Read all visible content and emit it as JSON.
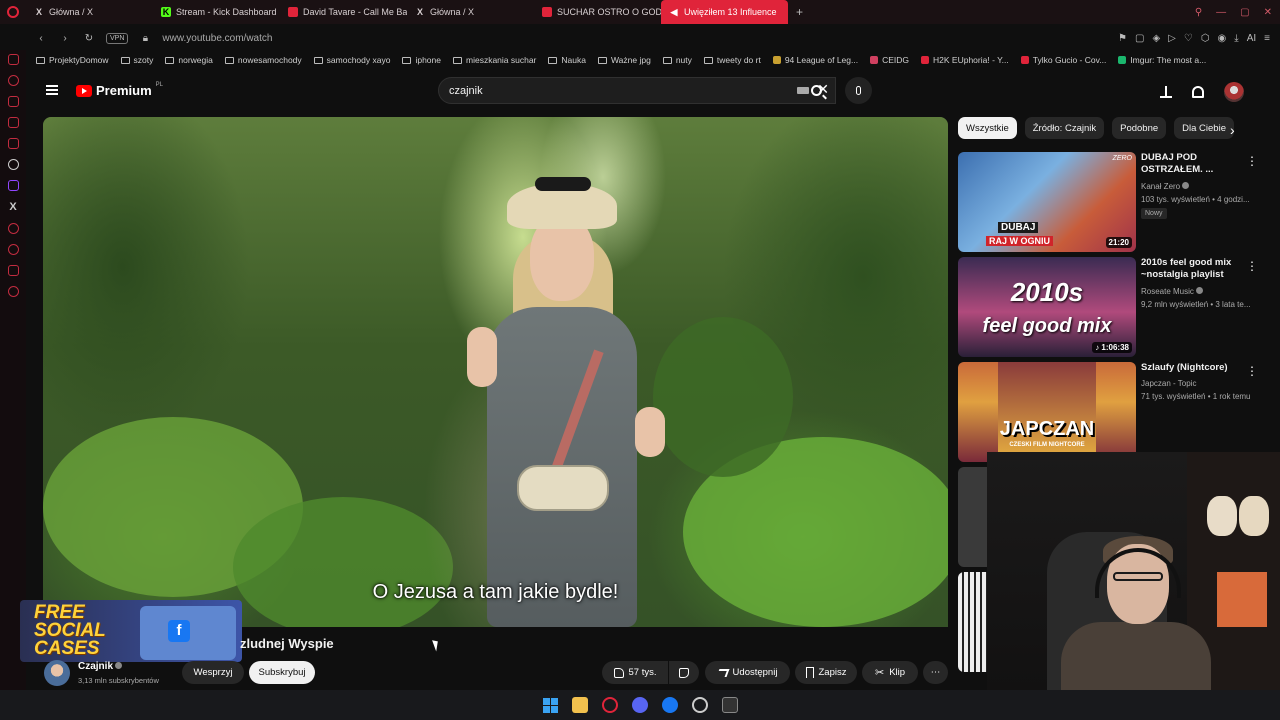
{
  "browser": {
    "tabs": [
      {
        "label": "Główna / X",
        "icon": "x-icon"
      },
      {
        "label": "Stream - Kick Dashboard",
        "icon": "kick-icon"
      },
      {
        "label": "David Tavare - Call Me Ba",
        "icon": "youtube-icon"
      },
      {
        "label": "Główna / X",
        "icon": "x-icon"
      },
      {
        "label": "SUCHAR OSTRO O GODZ",
        "icon": "youtube-icon"
      },
      {
        "label": "Uwięziłem 13 Influence",
        "icon": "speaker-icon",
        "active": true
      }
    ],
    "vpn": "VPN",
    "url": "www.youtube.com/watch",
    "bookmarks": [
      {
        "label": "ProjektyDomow",
        "type": "folder"
      },
      {
        "label": "szoty",
        "type": "folder"
      },
      {
        "label": "norwegia",
        "type": "folder"
      },
      {
        "label": "nowesamochody",
        "type": "folder"
      },
      {
        "label": "samochody xayo",
        "type": "folder"
      },
      {
        "label": "iphone",
        "type": "folder"
      },
      {
        "label": "mieszkania suchar",
        "type": "folder"
      },
      {
        "label": "Nauka",
        "type": "folder"
      },
      {
        "label": "Ważne jpg",
        "type": "folder"
      },
      {
        "label": "nuty",
        "type": "folder"
      },
      {
        "label": "tweety do rt",
        "type": "folder"
      },
      {
        "label": "94 League of Leg...",
        "type": "site"
      },
      {
        "label": "CEIDG",
        "type": "site"
      },
      {
        "label": "H2K EUphoria! - Y...",
        "type": "site"
      },
      {
        "label": "Tylko Gucio - Cov...",
        "type": "site"
      },
      {
        "label": "Imgur: The most a...",
        "type": "site"
      }
    ],
    "ai_label": "AI"
  },
  "youtube": {
    "logo_text": "Premium",
    "logo_region": "PL",
    "search_query": "czajnik",
    "player": {
      "subtitle": "O Jezusa a tam jakie bydle!"
    },
    "promo_text": "FREE SOCIAL CASES",
    "video_title": "zludnej Wyspie",
    "channel": {
      "name": "Czajnik",
      "subs": "3,13 mln subskrybentów"
    },
    "actions": {
      "support": "Wesprzyj",
      "subscribe": "Subskrybuj",
      "likes": "57 tys.",
      "share": "Udostępnij",
      "save": "Zapisz",
      "clip": "Klip"
    },
    "chips": [
      "Wszystkie",
      "Źródło: Czajnik",
      "Podobne",
      "Dla Ciebie"
    ],
    "recommendations": [
      {
        "title": "DUBAJ POD OSTRZAŁEM. ...",
        "channel": "Kanał Zero",
        "meta": "103 tys. wyświetleń • 4 godzi...",
        "badge": "Nowy",
        "duration": "21:20",
        "thumb_text_1": "DUBAJ",
        "thumb_text_2": "RAJ W OGNIU",
        "thumb_logo": "ZERO"
      },
      {
        "title": "2010s feel good mix ~nostalgia playlist",
        "channel": "Roseate Music",
        "meta": "9,2 mln wyświetleń • 3 lata te...",
        "duration": "1:06:38",
        "thumb_text_1": "2010s",
        "thumb_text_2": "feel good mix"
      },
      {
        "title": "Szlaufy (Nightcore)",
        "channel": "Japczan - Topic",
        "meta": "71 tys. wyświetleń • 1 rok temu",
        "thumb_text_1": "JAPCZAN",
        "thumb_text_2": "CZESKI FILM NIGHTCORE"
      }
    ]
  },
  "colors": {
    "accent": "#e0243a",
    "youtube_red": "#ff0000",
    "background": "#0f0f0f"
  }
}
